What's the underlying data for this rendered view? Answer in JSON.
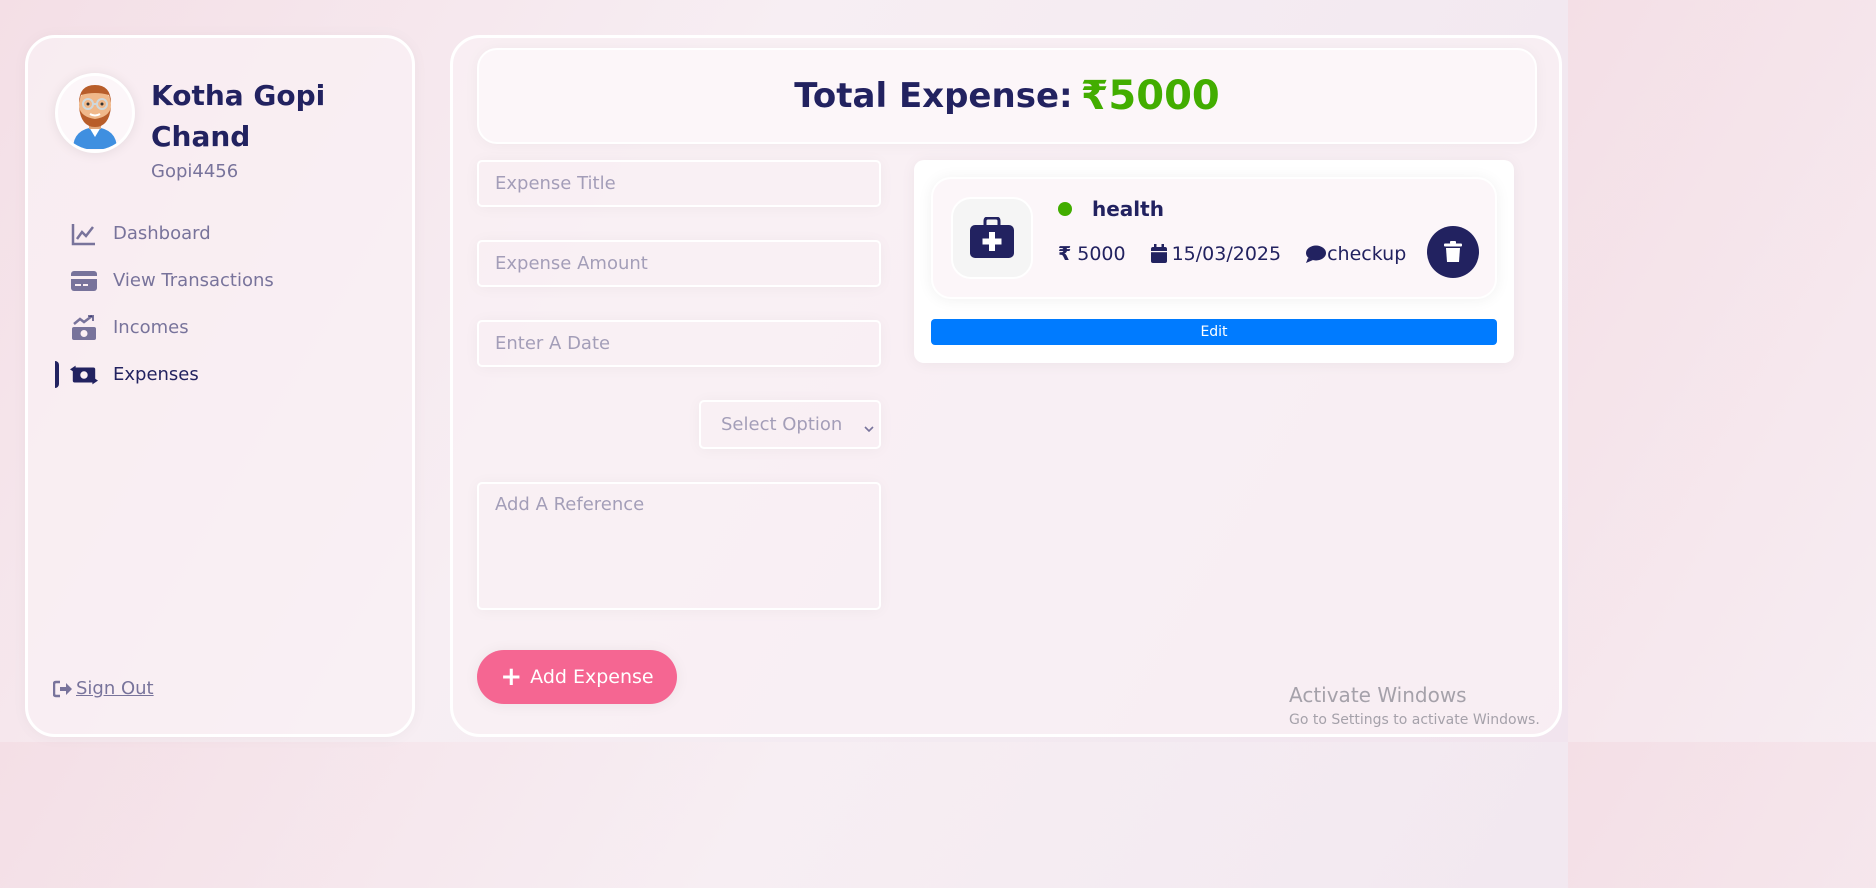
{
  "user": {
    "name": "Kotha Gopi Chand",
    "handle": "Gopi4456"
  },
  "nav": {
    "items": [
      {
        "label": "Dashboard",
        "icon": "chart-line-icon",
        "active": false
      },
      {
        "label": "View Transactions",
        "icon": "credit-card-icon",
        "active": false
      },
      {
        "label": "Incomes",
        "icon": "money-trend-icon",
        "active": false
      },
      {
        "label": "Expenses",
        "icon": "money-transfer-icon",
        "active": true
      }
    ],
    "signout_label": " Sign Out"
  },
  "total": {
    "label": "Total Expense:",
    "amount": "₹5000"
  },
  "form": {
    "title_placeholder": "Expense Title",
    "amount_placeholder": "Expense Amount",
    "date_placeholder": "Enter A Date",
    "category_value": "Select Option",
    "reference_placeholder": "Add A Reference",
    "submit_label": "Add Expense"
  },
  "expense_item": {
    "title": "health",
    "icon": "medical-kit-icon",
    "amount": "5000",
    "currency_symbol": "₹",
    "date": "15/03/2025",
    "note": "checkup",
    "edit_label": "Edit",
    "status_color": "#42AD00"
  },
  "watermark": {
    "title": "Activate Windows",
    "subtitle": "Go to Settings to activate Windows."
  },
  "colors": {
    "primary": "#222260",
    "accent_pink": "#F56692",
    "income_green": "#42AD00",
    "edit_blue": "#007bff"
  }
}
